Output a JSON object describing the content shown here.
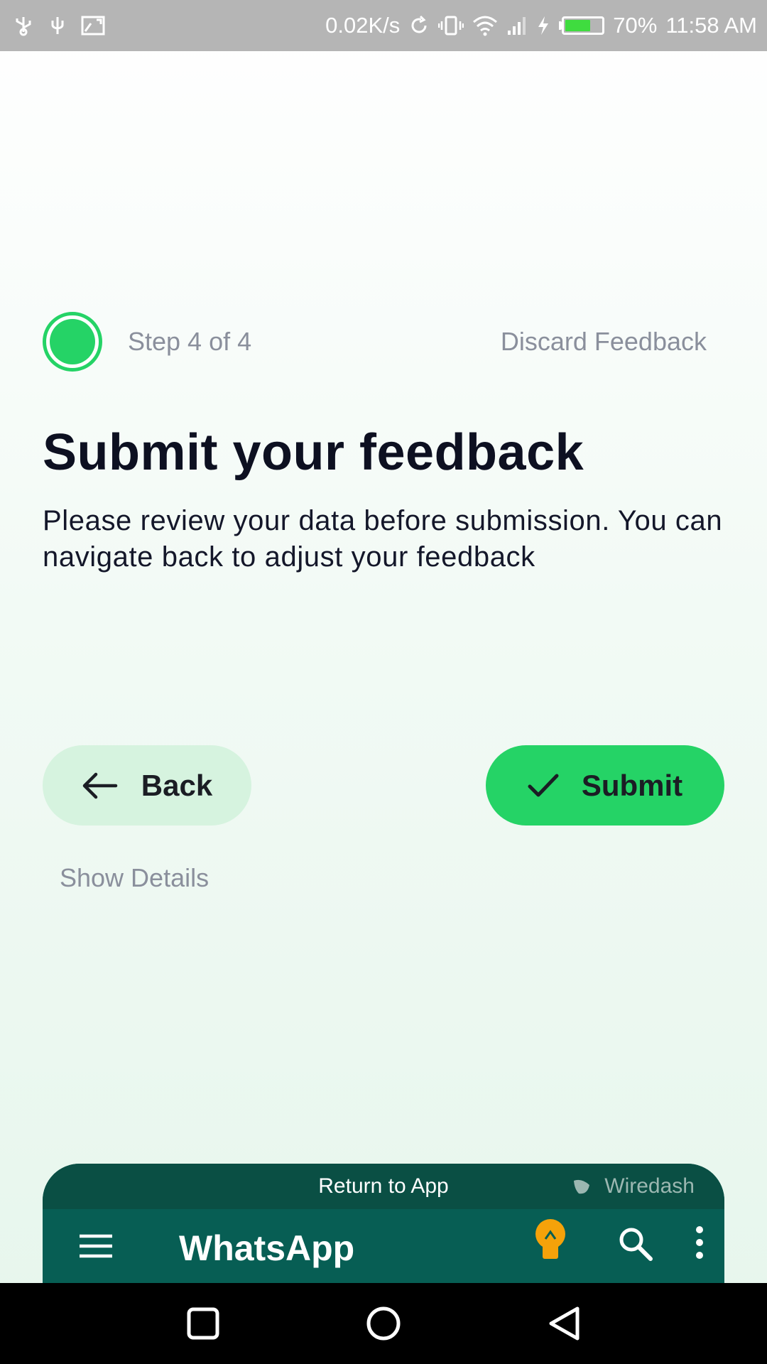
{
  "status_bar": {
    "network_speed": "0.02K/s",
    "battery_percent": "70%",
    "battery_level": 0.7,
    "time": "11:58 AM",
    "icons": [
      "usb-icon",
      "usb-icon",
      "screenshot-icon",
      "sync-icon",
      "vibrate-icon",
      "wifi-icon",
      "signal-icon",
      "charging-icon",
      "battery-icon"
    ]
  },
  "step": {
    "label": "Step 4 of 4",
    "discard": "Discard Feedback"
  },
  "content": {
    "title": "Submit your feedback",
    "subtitle": "Please review your data before submission. You can navigate back to adjust your feedback"
  },
  "actions": {
    "back_label": "Back",
    "submit_label": "Submit",
    "show_details": "Show Details"
  },
  "preview": {
    "return_label": "Return to App",
    "brand": "Wiredash",
    "app_title": "WhatsApp"
  },
  "colors": {
    "accent": "#25d366",
    "app_bar": "#075e54",
    "text": "#0d1021",
    "muted": "#8a8f9c"
  }
}
